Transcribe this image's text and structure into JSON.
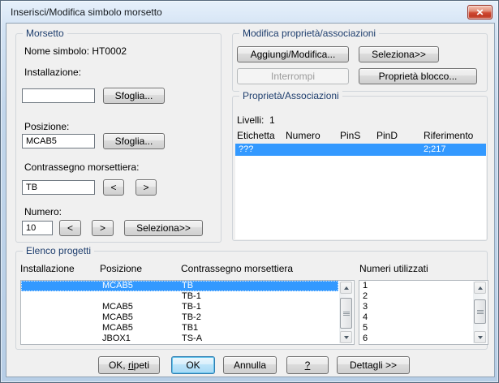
{
  "window": {
    "title": "Inserisci/Modifica simbolo morsetto",
    "colors": {
      "selection": "#3399ff",
      "titlebar_frame": "#c2d6eb",
      "client_bg": "#f0f0f0",
      "close_button_red": "#c03a24",
      "group_label_text": "#1e3e6e"
    },
    "icons": {
      "close": "close-x",
      "scroll_up": "triangle-up",
      "scroll_down": "triangle-down",
      "thumb_grip": "grip-lines"
    }
  },
  "morsetto": {
    "group_label": "Morsetto",
    "nome_simbolo_label": "Nome simbolo:",
    "nome_simbolo_value": "HT0002",
    "installazione_label": "Installazione:",
    "installazione_value": "",
    "sfoglia_installazione_label": "Sfoglia...",
    "posizione_label": "Posizione:",
    "posizione_value": "MCAB5",
    "sfoglia_posizione_label": "Sfoglia...",
    "contrassegno_label": "Contrassegno morsettiera:",
    "contrassegno_value": "TB",
    "contrassegno_prev_label": "<",
    "contrassegno_next_label": ">",
    "numero_label": "Numero:",
    "numero_value": "10",
    "numero_prev_label": "<",
    "numero_next_label": ">",
    "seleziona_label": "Seleziona>>"
  },
  "modifica": {
    "group_label": "Modifica proprietà/associazioni",
    "aggiungi_modifica_label": "Aggiungi/Modifica...",
    "seleziona_label": "Seleziona>>",
    "interrompi_label": "Interrompi",
    "proprieta_blocco_label": "Proprietà blocco..."
  },
  "proprieta": {
    "group_label": "Proprietà/Associazioni",
    "livelli_label": "Livelli:",
    "livelli_value": "1",
    "columns": [
      "Etichetta",
      "Numero",
      "PinS",
      "PinD",
      "Riferimento"
    ],
    "selected_row": {
      "etichetta": "???",
      "numero": "",
      "pins": "",
      "pind": "",
      "riferimento": "2;217"
    }
  },
  "elenco": {
    "group_label": "Elenco progetti",
    "columns": [
      "Installazione",
      "Posizione",
      "Contrassegno morsettiera"
    ],
    "numeri_label": "Numeri utilizzati",
    "rows": [
      {
        "installazione": "",
        "posizione": "MCAB5",
        "contrassegno": "TB"
      },
      {
        "installazione": "",
        "posizione": "",
        "contrassegno": "TB-1"
      },
      {
        "installazione": "",
        "posizione": "MCAB5",
        "contrassegno": "TB-1"
      },
      {
        "installazione": "",
        "posizione": "MCAB5",
        "contrassegno": "TB-2"
      },
      {
        "installazione": "",
        "posizione": "MCAB5",
        "contrassegno": "TB1"
      },
      {
        "installazione": "",
        "posizione": "JBOX1",
        "contrassegno": "TS-A"
      }
    ],
    "numeri_utilizzati": [
      "1",
      "2",
      "3",
      "4",
      "5",
      "6"
    ]
  },
  "footer": {
    "ok_ripeti_pre": "OK, ",
    "ok_ripeti_accesskey": "ri",
    "ok_ripeti_post": "peti",
    "ok_label": "OK",
    "annulla_label": "Annulla",
    "help_label": "?",
    "dettagli_label": "Dettagli >>"
  }
}
